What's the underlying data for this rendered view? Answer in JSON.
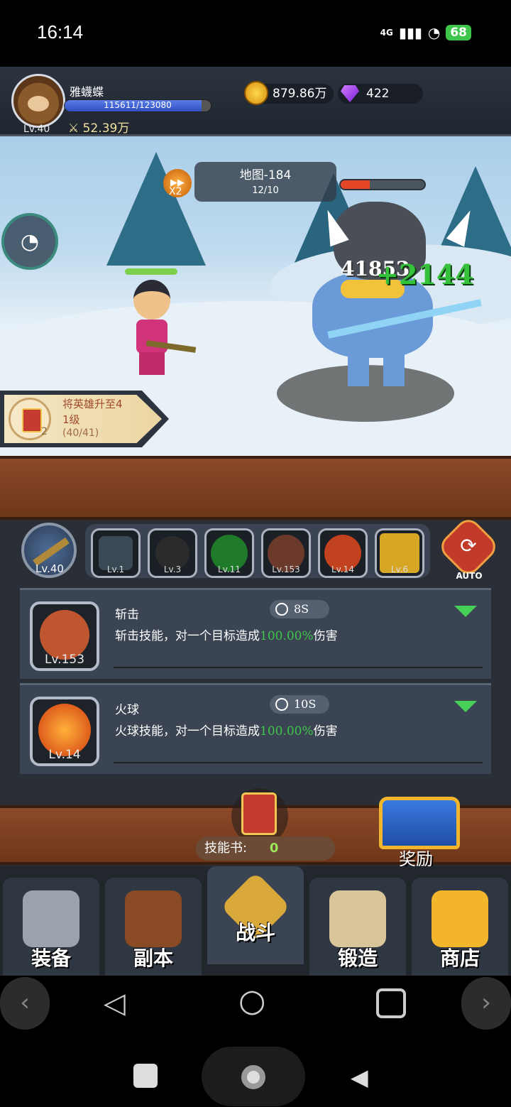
{
  "status": {
    "time": "16:14",
    "network": "4G",
    "battery": "68"
  },
  "player": {
    "name": "雅蠛蝶",
    "level": "Lv.40",
    "xp_text": "115611/123080",
    "xp_fraction": 0.939,
    "power": "52.39万"
  },
  "resources": {
    "gold": "879.86万",
    "gems": "422"
  },
  "battle": {
    "speed_label": "X2",
    "map_title": "地图-184",
    "map_progress": "12/10",
    "enemy_hp_fraction": 0.35,
    "hero_hp_fraction": 1.0,
    "damage_white": "41853",
    "damage_green": "+2144"
  },
  "quest": {
    "line1": "将英雄升至4",
    "line2": "1级",
    "progress": "(40/41)",
    "count": "2"
  },
  "skills_bar": {
    "weapon_level": "Lv.40",
    "slots": [
      {
        "level": "Lv.1",
        "color": "#3a4a55"
      },
      {
        "level": "Lv.3",
        "color": "#2b2b2b"
      },
      {
        "level": "Lv.11",
        "color": "#1f7a2a"
      },
      {
        "level": "Lv.153",
        "color": "#6b3a2a"
      },
      {
        "level": "Lv.14",
        "color": "#c2411e"
      },
      {
        "level": "Lv.6",
        "color": "#d6a624"
      }
    ],
    "auto_label": "AUTO"
  },
  "skill_cards": [
    {
      "name": "斩击",
      "cooldown": "8S",
      "desc_before": "斩击技能，对一个目标造成",
      "desc_pct": "100.00%",
      "desc_after": "伤害",
      "level": "Lv.153"
    },
    {
      "name": "火球",
      "cooldown": "10S",
      "desc_before": "火球技能，对一个目标造成",
      "desc_pct": "100.00%",
      "desc_after": "伤害",
      "level": "Lv.14"
    }
  ],
  "skill_book": {
    "label": "技能书:",
    "count": "0"
  },
  "reward": {
    "label": "奖励"
  },
  "bottom_nav": [
    {
      "label": "装备"
    },
    {
      "label": "副本"
    },
    {
      "label": "战斗"
    },
    {
      "label": "锻造"
    },
    {
      "label": "商店"
    }
  ]
}
